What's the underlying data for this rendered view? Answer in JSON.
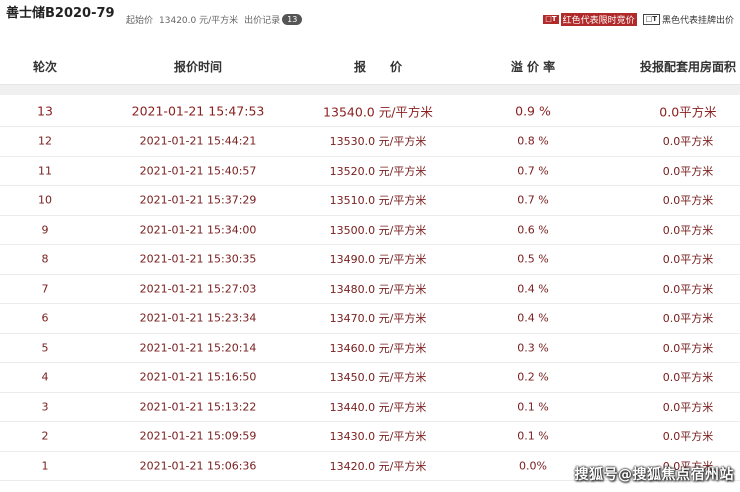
{
  "header": {
    "title": "善士储B2020-79",
    "start_price_label": "起始价",
    "start_price_value": "13420.0 元/平方米",
    "records_label": "出价记录",
    "records_count": "13"
  },
  "legend": {
    "red_mark": "□T",
    "red_text": "红色代表限时竞价",
    "black_mark": "□T",
    "black_text": "黑色代表挂牌出价"
  },
  "table": {
    "columns": [
      "轮次",
      "报价时间",
      "报　　价",
      "溢 价 率",
      "投报配套用房面积"
    ],
    "rows": [
      {
        "round": "13",
        "time": "2021-01-21 15:47:53",
        "price": "13540.0 元/平方米",
        "rate": "0.9 %",
        "area": "0.0平方米"
      },
      {
        "round": "12",
        "time": "2021-01-21 15:44:21",
        "price": "13530.0 元/平方米",
        "rate": "0.8 %",
        "area": "0.0平方米"
      },
      {
        "round": "11",
        "time": "2021-01-21 15:40:57",
        "price": "13520.0 元/平方米",
        "rate": "0.7 %",
        "area": "0.0平方米"
      },
      {
        "round": "10",
        "time": "2021-01-21 15:37:29",
        "price": "13510.0 元/平方米",
        "rate": "0.7 %",
        "area": "0.0平方米"
      },
      {
        "round": "9",
        "time": "2021-01-21 15:34:00",
        "price": "13500.0 元/平方米",
        "rate": "0.6 %",
        "area": "0.0平方米"
      },
      {
        "round": "8",
        "time": "2021-01-21 15:30:35",
        "price": "13490.0 元/平方米",
        "rate": "0.5 %",
        "area": "0.0平方米"
      },
      {
        "round": "7",
        "time": "2021-01-21 15:27:03",
        "price": "13480.0 元/平方米",
        "rate": "0.4 %",
        "area": "0.0平方米"
      },
      {
        "round": "6",
        "time": "2021-01-21 15:23:34",
        "price": "13470.0 元/平方米",
        "rate": "0.4 %",
        "area": "0.0平方米"
      },
      {
        "round": "5",
        "time": "2021-01-21 15:20:14",
        "price": "13460.0 元/平方米",
        "rate": "0.3 %",
        "area": "0.0平方米"
      },
      {
        "round": "4",
        "time": "2021-01-21 15:16:50",
        "price": "13450.0 元/平方米",
        "rate": "0.2 %",
        "area": "0.0平方米"
      },
      {
        "round": "3",
        "time": "2021-01-21 15:13:22",
        "price": "13440.0 元/平方米",
        "rate": "0.1 %",
        "area": "0.0平方米"
      },
      {
        "round": "2",
        "time": "2021-01-21 15:09:59",
        "price": "13430.0 元/平方米",
        "rate": "0.1 %",
        "area": "0.0平方米"
      },
      {
        "round": "1",
        "time": "2021-01-21 15:06:36",
        "price": "13420.0 元/平方米",
        "rate": "0.0%",
        "area": "0.0平方米"
      }
    ]
  },
  "watermark": "搜狐号@搜狐焦点宿州站",
  "colors": {
    "accent_red": "#b02a2a",
    "row_text": "#7a2020"
  }
}
